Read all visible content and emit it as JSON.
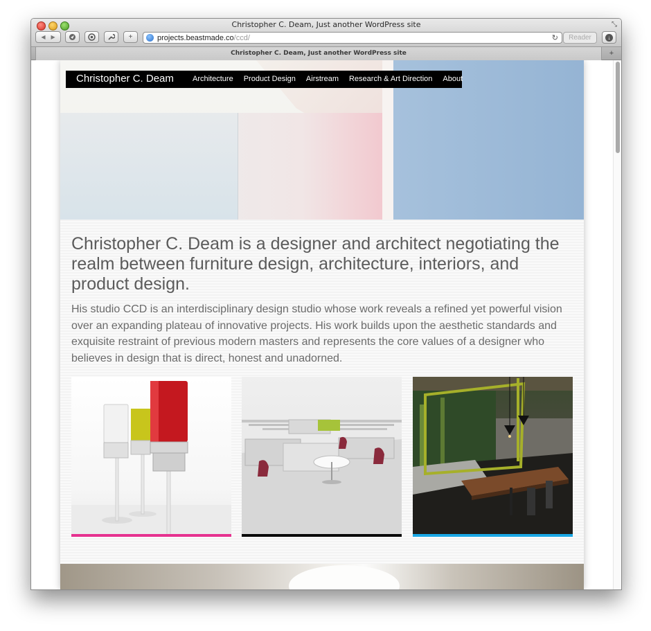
{
  "browser": {
    "window_title": "Christopher C. Deam, Just another WordPress site",
    "tab_title": "Christopher C. Deam, Just another WordPress site",
    "url_host": "projects.beastmade.co",
    "url_path": "/ccd/",
    "reader_label": "Reader",
    "new_tab_label": "+",
    "add_bookmark_label": "+"
  },
  "site": {
    "title": "Christopher C. Deam",
    "nav": [
      {
        "label": "Architecture"
      },
      {
        "label": "Product Design"
      },
      {
        "label": "Airstream"
      },
      {
        "label": "Research & Art Direction"
      },
      {
        "label": "About"
      }
    ],
    "headline": "Christopher C. Deam is a designer and architect negotiating the realm between furniture design, architecture, interiors, and product design.",
    "intro": "His studio CCD is an interdisciplinary design studio whose work reveals a refined yet powerful vision over an expanding plateau of innovative projects.  His work builds upon the aesthetic standards and exquisite restraint of previous modern masters and represents the core values of a designer who believes in design that is direct, honest and unadorned."
  },
  "thumbnails": [
    {
      "subject": "lamps",
      "accent": "#e6318f"
    },
    {
      "subject": "office-workstation",
      "accent": "#0a0a0a"
    },
    {
      "subject": "dining-interior",
      "accent": "#1aa8e6"
    }
  ]
}
